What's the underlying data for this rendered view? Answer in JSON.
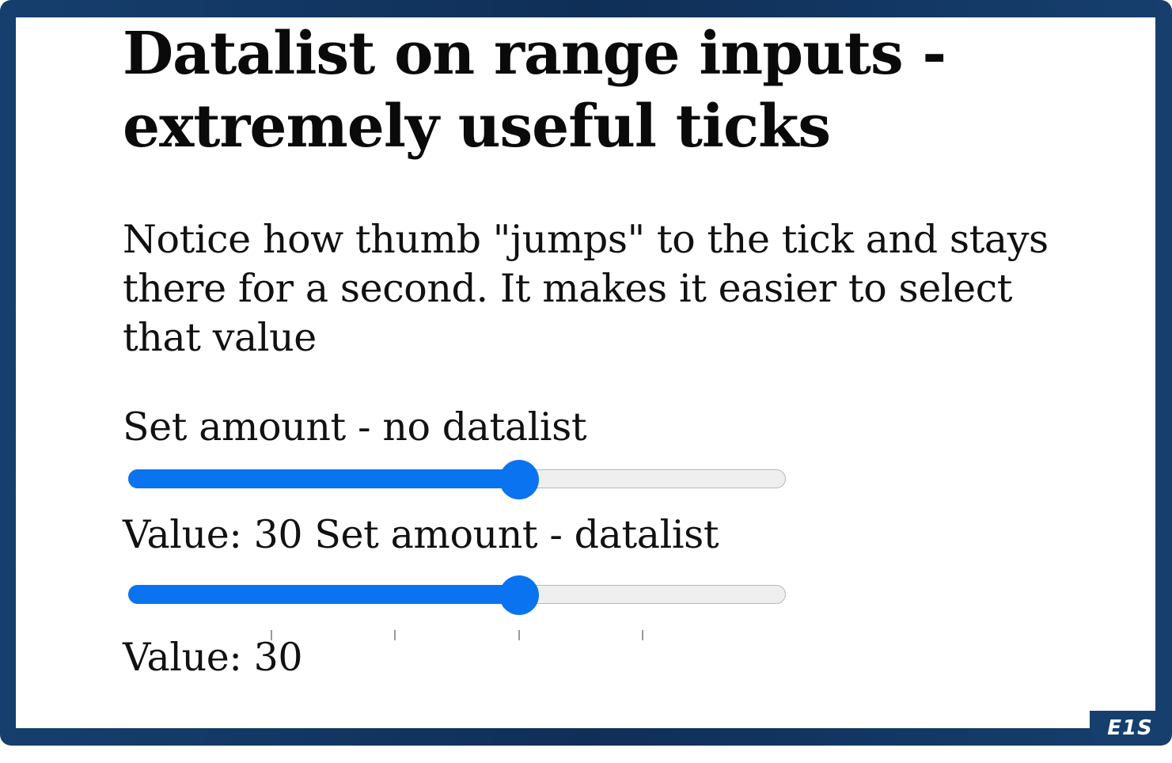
{
  "page": {
    "title": "Datalist on range inputs - extremely useful ticks",
    "description": "Notice how thumb \"jumps\" to the tick and stays there for a second. It makes it easier to select that value"
  },
  "slider_no_datalist": {
    "label": "Set amount - no datalist",
    "min": 0,
    "max": 50,
    "value": 30,
    "value_text": "Value: 30"
  },
  "slider_datalist": {
    "label": "Set amount - datalist",
    "min": 0,
    "max": 50,
    "value": 30,
    "ticks": [
      10,
      20,
      30,
      40
    ],
    "value_text": "Value: 30"
  },
  "colors": {
    "accent": "#0a73f0",
    "frame": "#163f6e",
    "track": "#efefef"
  },
  "badge": {
    "text": "E1S"
  }
}
